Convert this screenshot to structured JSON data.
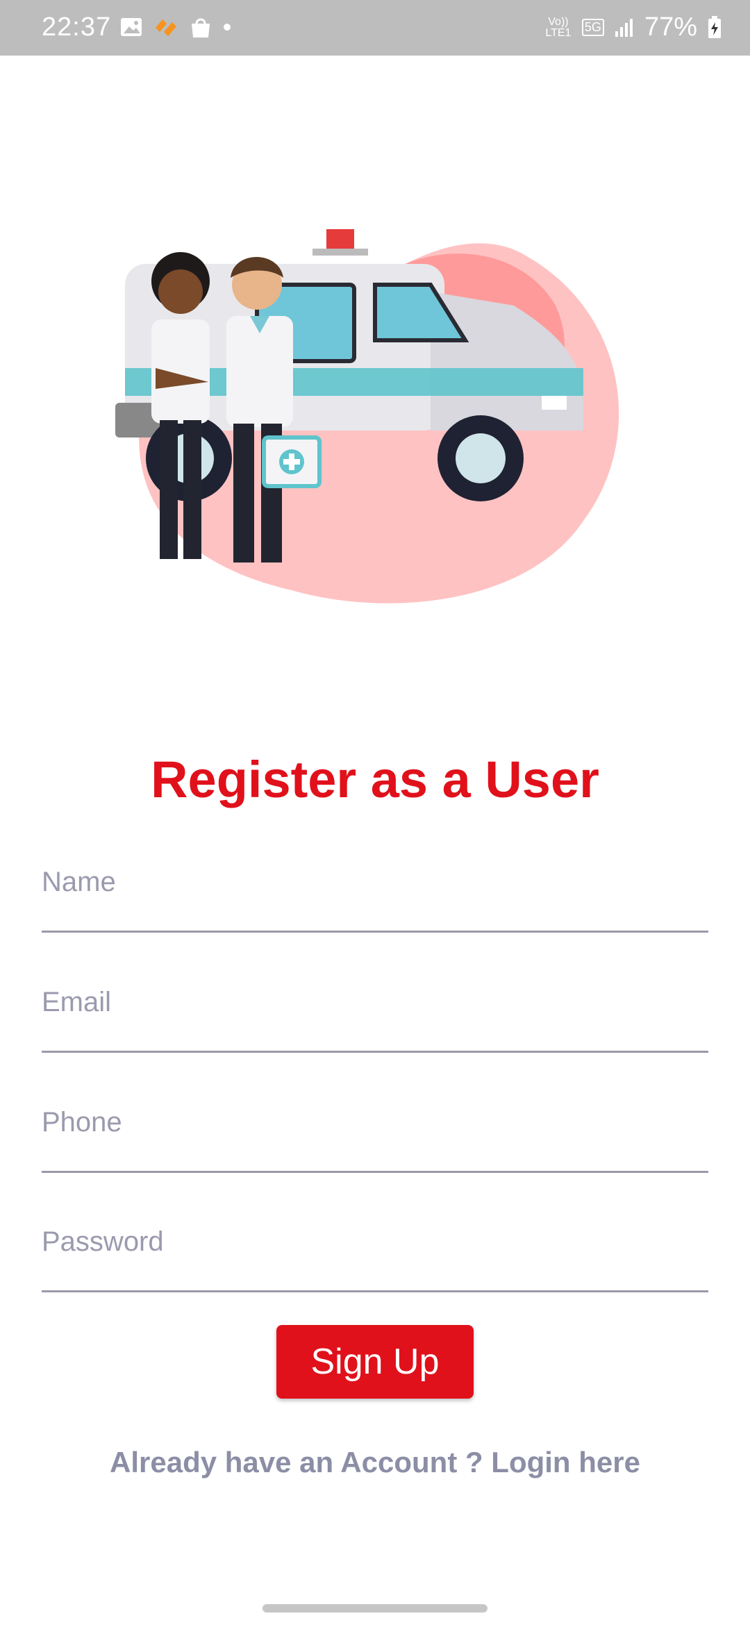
{
  "status_bar": {
    "time": "22:37",
    "network_volte": "Vo)) LTE1",
    "network_5g": "5G",
    "battery": "77%",
    "icons": [
      "gallery-icon",
      "app-notification-icon",
      "shopping-bag-icon",
      "dot-icon",
      "signal-icon",
      "battery-charging-icon"
    ]
  },
  "illustration": {
    "name": "ambulance-with-paramedics",
    "accent_color": "#ff6b6b"
  },
  "page": {
    "title": "Register as a User"
  },
  "form": {
    "name_placeholder": "Name",
    "email_placeholder": "Email",
    "phone_placeholder": "Phone",
    "password_placeholder": "Password"
  },
  "actions": {
    "signup_label": "Sign Up",
    "login_link": "Already have an Account ? Login here"
  },
  "colors": {
    "brand_red": "#e0111b",
    "placeholder_gray": "#9a9aaf"
  }
}
